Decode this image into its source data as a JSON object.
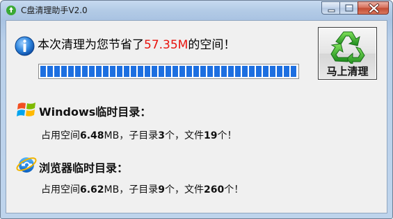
{
  "window": {
    "title": "C盘清理助手V2.0"
  },
  "headline": {
    "prefix": "本次清理为您节省了",
    "amount": "57.35M",
    "suffix": "的空间！"
  },
  "progress": {
    "value": 1.0
  },
  "clean_button": {
    "label": "马上清理",
    "icon": "recycle-icon"
  },
  "windows_section": {
    "title": "Windows临时目录：",
    "icon": "windows-logo-icon",
    "used_prefix": "占用空间",
    "used_value": "6.48",
    "used_unit": "MB，子目录",
    "subdirs": "3",
    "files_prefix": "个，文件",
    "files": "19",
    "files_suffix": "个！"
  },
  "browser_section": {
    "title": "浏览器临时目录：",
    "icon": "internet-explorer-icon",
    "used_prefix": "占用空间",
    "used_value": "6.62",
    "used_unit": "MB，子目录",
    "subdirs": "9",
    "files_prefix": "个，文件",
    "files": "260",
    "files_suffix": "个！"
  },
  "colors": {
    "accent_red": "#e8120c",
    "progress_blue": "#1d6fe0"
  }
}
